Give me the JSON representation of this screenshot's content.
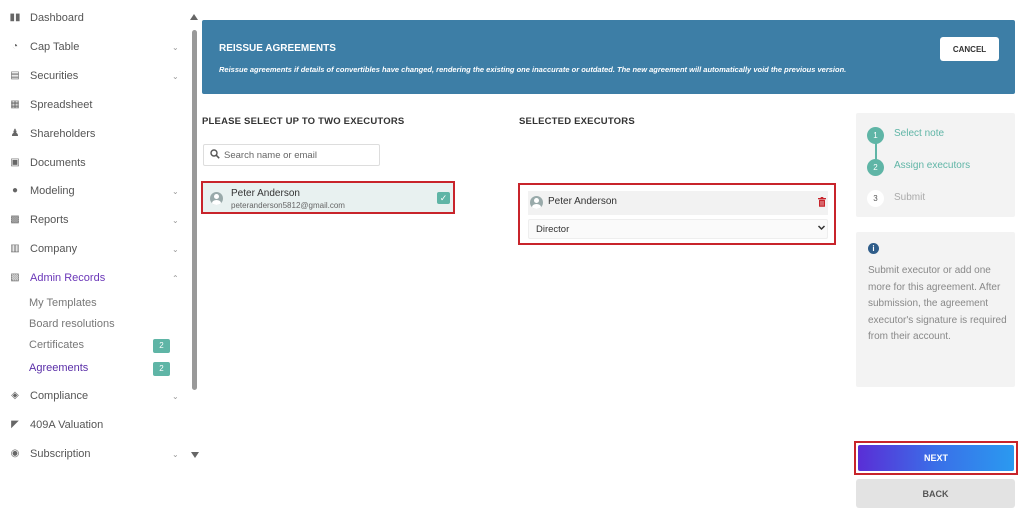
{
  "sidebar": {
    "items": [
      {
        "label": "Dashboard",
        "icon": "dashboard-icon",
        "has_chevron": false
      },
      {
        "label": "Cap Table",
        "icon": "pie-chart-icon",
        "has_chevron": true
      },
      {
        "label": "Securities",
        "icon": "document-icon",
        "has_chevron": true
      },
      {
        "label": "Spreadsheet",
        "icon": "spreadsheet-icon",
        "has_chevron": false
      },
      {
        "label": "Shareholders",
        "icon": "user-icon",
        "has_chevron": false
      },
      {
        "label": "Documents",
        "icon": "folder-icon",
        "has_chevron": false
      },
      {
        "label": "Modeling",
        "icon": "bulb-icon",
        "has_chevron": true
      },
      {
        "label": "Reports",
        "icon": "report-icon",
        "has_chevron": true
      },
      {
        "label": "Company",
        "icon": "building-icon",
        "has_chevron": true
      },
      {
        "label": "Admin Records",
        "icon": "admin-icon",
        "has_chevron": true,
        "expanded": true
      },
      {
        "label": "Compliance",
        "icon": "shield-icon",
        "has_chevron": true
      },
      {
        "label": "409A Valuation",
        "icon": "valuation-icon",
        "has_chevron": false
      },
      {
        "label": "Subscription",
        "icon": "dollar-icon",
        "has_chevron": true
      }
    ],
    "sub_items": [
      {
        "label": "My Templates"
      },
      {
        "label": "Board resolutions"
      },
      {
        "label": "Certificates",
        "badge": "2"
      },
      {
        "label": "Agreements",
        "badge": "2",
        "active": true
      }
    ]
  },
  "banner": {
    "title": "REISSUE AGREEMENTS",
    "description": "Reissue agreements if details of convertibles have changed, rendering the existing one inaccurate or outdated. The new agreement will automatically void the previous version.",
    "cancel_label": "CANCEL"
  },
  "left_column": {
    "title": "PLEASE SELECT UP TO TWO EXECUTORS",
    "search_placeholder": "Search name or email",
    "executor": {
      "name": "Peter Anderson",
      "email": "peteranderson5812@gmail.com",
      "checked": true
    }
  },
  "right_column": {
    "title": "SELECTED EXECUTORS",
    "selected": {
      "name": "Peter Anderson",
      "role": "Director"
    },
    "role_options": [
      "Director"
    ]
  },
  "stepper": {
    "steps": [
      {
        "num": "1",
        "label": "Select note",
        "status": "done"
      },
      {
        "num": "2",
        "label": "Assign executors",
        "status": "done"
      },
      {
        "num": "3",
        "label": "Submit",
        "status": "pending"
      }
    ]
  },
  "info": {
    "text": "Submit executor or add one more for this agreement. After submission, the agreement executor's signature is required from their account."
  },
  "actions": {
    "next_label": "NEXT",
    "back_label": "BACK"
  },
  "colors": {
    "banner": "#3d7ea6",
    "accent_teal": "#5fb5a6",
    "highlight_red": "#c8242b",
    "active_purple": "#6a36b8"
  }
}
